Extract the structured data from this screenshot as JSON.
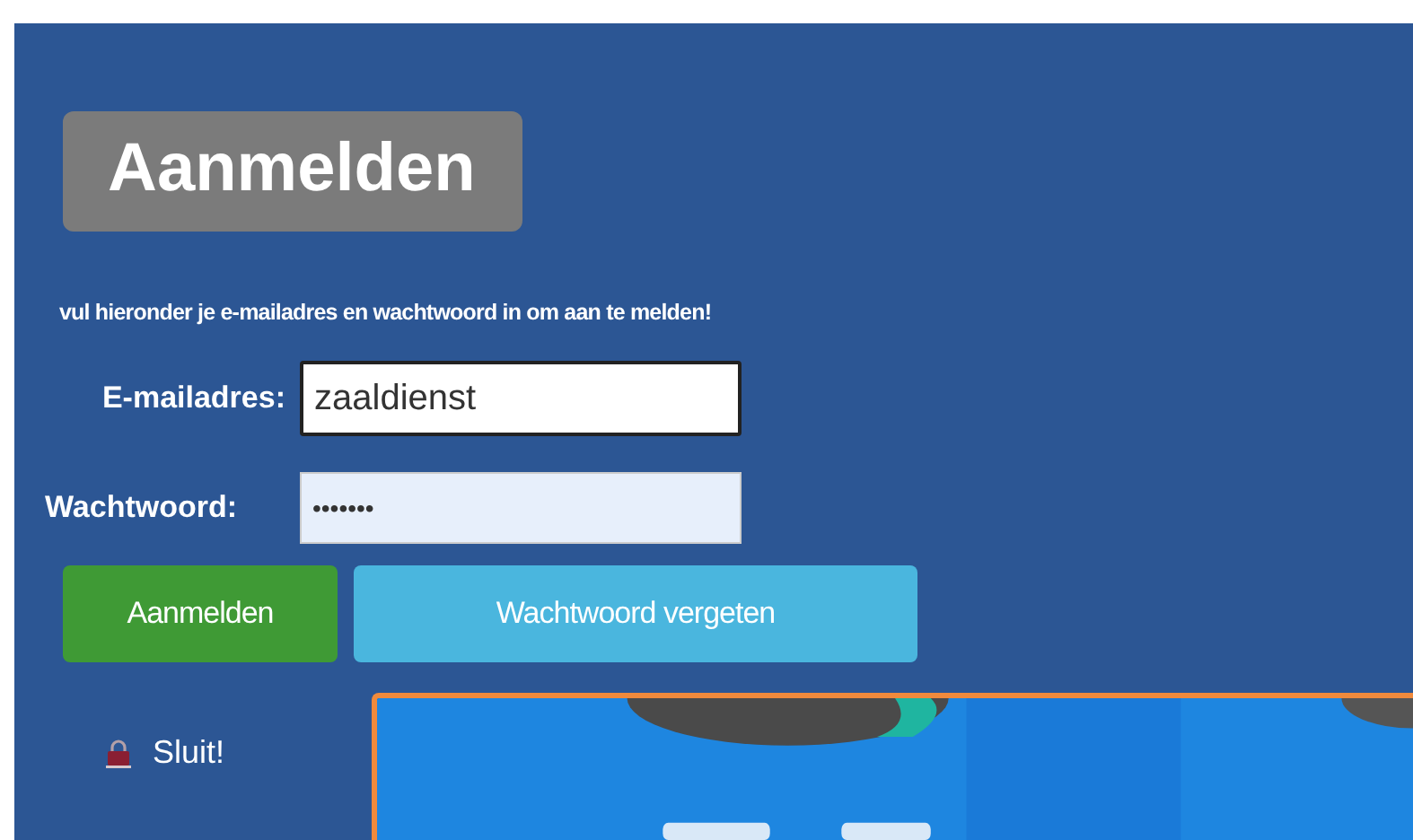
{
  "title": "Aanmelden",
  "instruction": "vul hieronder je e-mailadres en wachtwoord in om aan te melden!",
  "fields": [
    {
      "label": "E-mailadres:",
      "value": "zaaldienst",
      "kind": "text",
      "focused": true
    },
    {
      "label": "Wachtwoord:",
      "value": "•••••••",
      "kind": "password",
      "focused": false
    }
  ],
  "buttons": [
    {
      "label": "Aanmelden",
      "kind": "primary"
    },
    {
      "label": "Wachtwoord vergeten",
      "kind": "info"
    }
  ],
  "close_link": "Sluit!"
}
